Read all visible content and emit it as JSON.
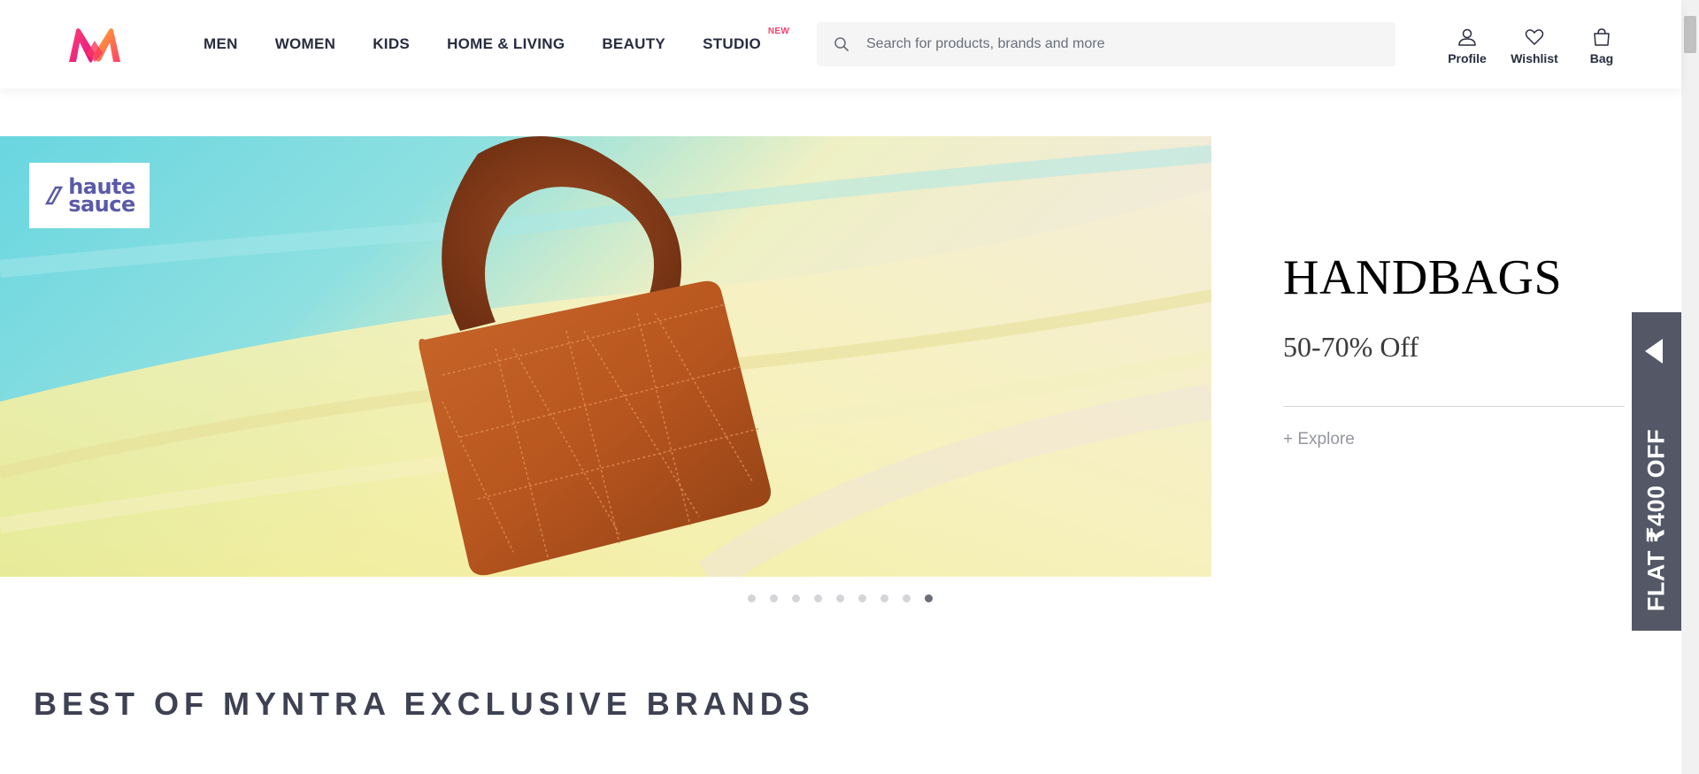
{
  "header": {
    "nav": [
      {
        "label": "MEN"
      },
      {
        "label": "WOMEN"
      },
      {
        "label": "KIDS"
      },
      {
        "label": "HOME & LIVING"
      },
      {
        "label": "BEAUTY"
      },
      {
        "label": "STUDIO",
        "badge": "NEW"
      }
    ],
    "search": {
      "placeholder": "Search for products, brands and more",
      "value": ""
    },
    "actions": [
      {
        "label": "Profile",
        "icon": "profile-icon"
      },
      {
        "label": "Wishlist",
        "icon": "heart-icon"
      },
      {
        "label": "Bag",
        "icon": "bag-icon"
      }
    ]
  },
  "banner": {
    "brand_line1": "haute",
    "brand_line2": "sauce",
    "title": "HANDBAGS",
    "subtitle": "50-70% Off",
    "link": "+ Explore",
    "slide_count": 9,
    "active_slide": 9
  },
  "coupon": {
    "text": "FLAT ₹400 OFF"
  },
  "section": {
    "title": "BEST OF MYNTRA EXCLUSIVE BRANDS"
  },
  "colors": {
    "accent": "#ff3f6c",
    "coupon_bg": "#535766",
    "text": "#282c3f"
  }
}
